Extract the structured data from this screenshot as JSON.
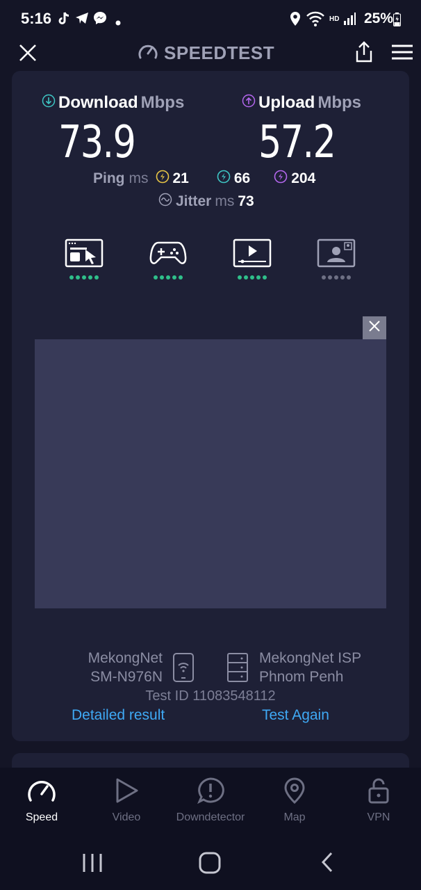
{
  "status_bar": {
    "time": "5:16",
    "hd": "HD",
    "battery": "25%"
  },
  "app": {
    "title": "SPEEDTEST"
  },
  "download": {
    "label": "Download",
    "unit": "Mbps",
    "value": "73.9"
  },
  "upload": {
    "label": "Upload",
    "unit": "Mbps",
    "value": "57.2"
  },
  "ping": {
    "label": "Ping",
    "unit": "ms",
    "idle": "21",
    "download": "66",
    "upload": "204"
  },
  "jitter": {
    "label": "Jitter",
    "unit": "ms",
    "value": "73"
  },
  "quality": [
    {
      "name": "browsing",
      "rating": 5
    },
    {
      "name": "gaming",
      "rating": 5
    },
    {
      "name": "streaming",
      "rating": 5
    },
    {
      "name": "video-call",
      "rating": 0
    }
  ],
  "provider": {
    "name": "MekongNet",
    "device": "SM-N976N",
    "server_name": "MekongNet ISP",
    "server_location": "Phnom Penh",
    "test_id": "Test ID 11083548112"
  },
  "actions": {
    "detailed": "Detailed result",
    "again": "Test Again"
  },
  "nav": {
    "speed": "Speed",
    "video": "Video",
    "downdetector": "Downdetector",
    "map": "Map",
    "vpn": "VPN"
  },
  "colors": {
    "background": "#141526",
    "card": "#1e2036",
    "download_accent": "#3ec6c4",
    "upload_accent": "#b467ee",
    "link": "#3fa9f5",
    "quality_on": "#2fbf8a"
  }
}
